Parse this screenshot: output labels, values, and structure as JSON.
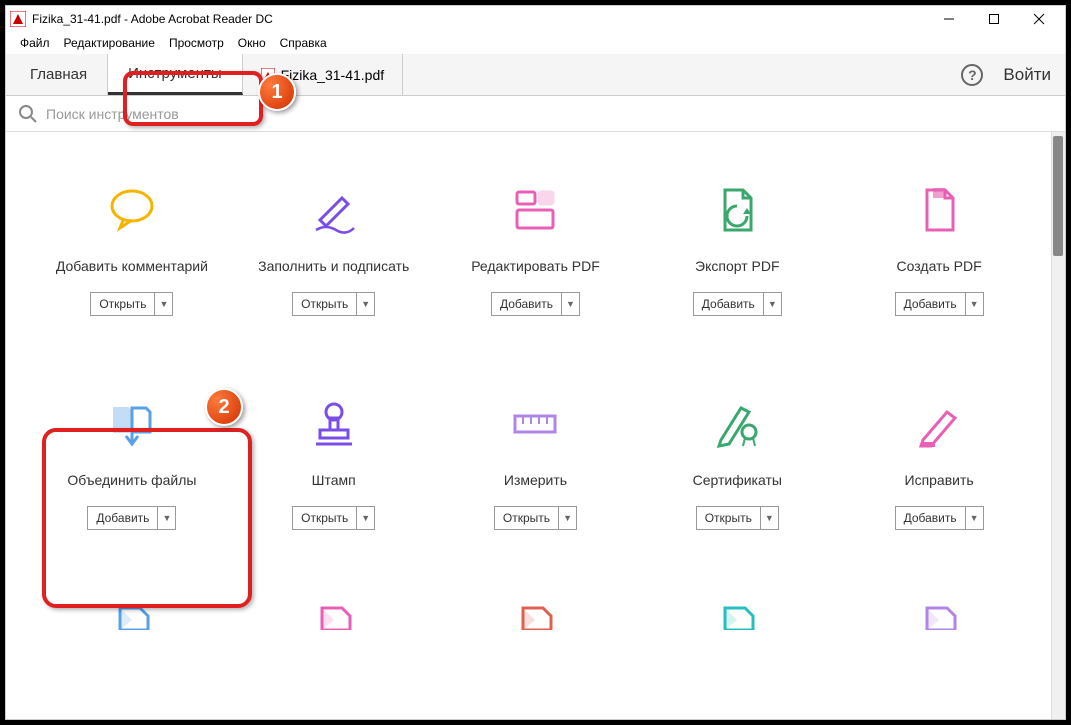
{
  "window": {
    "title": "Fizika_31-41.pdf - Adobe Acrobat Reader DC"
  },
  "menu": {
    "file": "Файл",
    "edit": "Редактирование",
    "view": "Просмотр",
    "window": "Окно",
    "help": "Справка"
  },
  "tabs": {
    "home": "Главная",
    "tools": "Инструменты",
    "doc": "Fizika_31-41.pdf",
    "login": "Войти"
  },
  "search": {
    "placeholder": "Поиск инструментов"
  },
  "buttons": {
    "open": "Открыть",
    "add": "Добавить"
  },
  "tools": [
    {
      "label": "Добавить комментарий",
      "action": "open",
      "color": "#f5b400",
      "icon": "comment"
    },
    {
      "label": "Заполнить и подписать",
      "action": "open",
      "color": "#7a4de8",
      "icon": "sign"
    },
    {
      "label": "Редактировать PDF",
      "action": "add",
      "color": "#e85fb6",
      "icon": "edit"
    },
    {
      "label": "Экспорт PDF",
      "action": "add",
      "color": "#3aa76d",
      "icon": "export"
    },
    {
      "label": "Создать PDF",
      "action": "add",
      "color": "#e85fb6",
      "icon": "create"
    },
    {
      "label": "Объединить файлы",
      "action": "add",
      "color": "#5aa0e8",
      "icon": "combine"
    },
    {
      "label": "Штамп",
      "action": "open",
      "color": "#7a4de8",
      "icon": "stamp"
    },
    {
      "label": "Измерить",
      "action": "open",
      "color": "#b085e8",
      "icon": "measure"
    },
    {
      "label": "Сертификаты",
      "action": "open",
      "color": "#3aa76d",
      "icon": "cert"
    },
    {
      "label": "Исправить",
      "action": "add",
      "color": "#e85fb6",
      "icon": "redact"
    }
  ],
  "partial_row_colors": [
    "#5aa0e8",
    "#e85fb6",
    "#e0604f",
    "#26bfbf",
    "#b085e8"
  ],
  "callouts": {
    "one": "1",
    "two": "2"
  }
}
